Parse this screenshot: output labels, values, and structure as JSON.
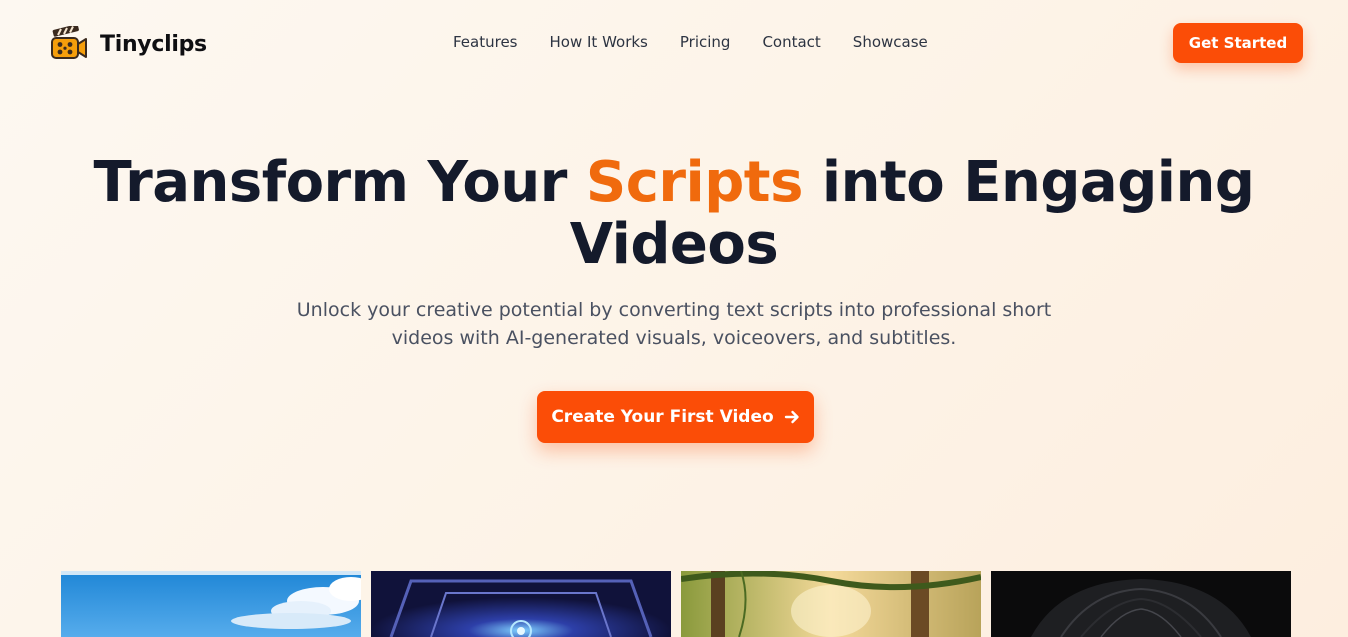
{
  "brand": {
    "name": "Tinyclips",
    "logo_icon": "clapperboard-camera-icon",
    "accent_color": "#fb4d07",
    "highlight_color": "#f06a0d"
  },
  "nav": {
    "items": [
      {
        "label": "Features"
      },
      {
        "label": "How It Works"
      },
      {
        "label": "Pricing"
      },
      {
        "label": "Contact"
      },
      {
        "label": "Showcase"
      }
    ],
    "cta_label": "Get Started"
  },
  "hero": {
    "title_before": "Transform Your ",
    "title_highlight": "Scripts",
    "title_after": " into Engaging Videos",
    "subtitle": "Unlock your creative potential by converting text scripts into professional short videos with AI-generated visuals, voiceovers, and subtitles.",
    "cta_label": "Create Your First Video",
    "cta_icon": "arrow-right-icon"
  },
  "showcase": {
    "thumbnails": [
      {
        "scene": "anime-sky-clouds"
      },
      {
        "scene": "fantasy-temple-portal"
      },
      {
        "scene": "sunlit-forest"
      },
      {
        "scene": "dark-hair-portrait"
      }
    ]
  }
}
